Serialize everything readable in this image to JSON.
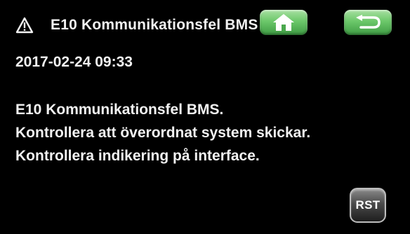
{
  "header": {
    "title": "E10 Kommunikationsfel BMS",
    "warning_icon": "warning-triangle-icon",
    "home_icon": "home-icon",
    "back_icon": "back-arrow-icon"
  },
  "alarm": {
    "timestamp": "2017-02-24 09:33",
    "message_lines": [
      "E10 Kommunikationsfel BMS.",
      "Kontrollera att överordnat system skickar.",
      "Kontrollera indikering på interface."
    ]
  },
  "controls": {
    "reset_label": "RST"
  },
  "colors": {
    "background": "#000000",
    "text": "#f2f2f2",
    "nav_button_green": "#6cc86a",
    "reset_button_gray": "#4a4a4a"
  }
}
